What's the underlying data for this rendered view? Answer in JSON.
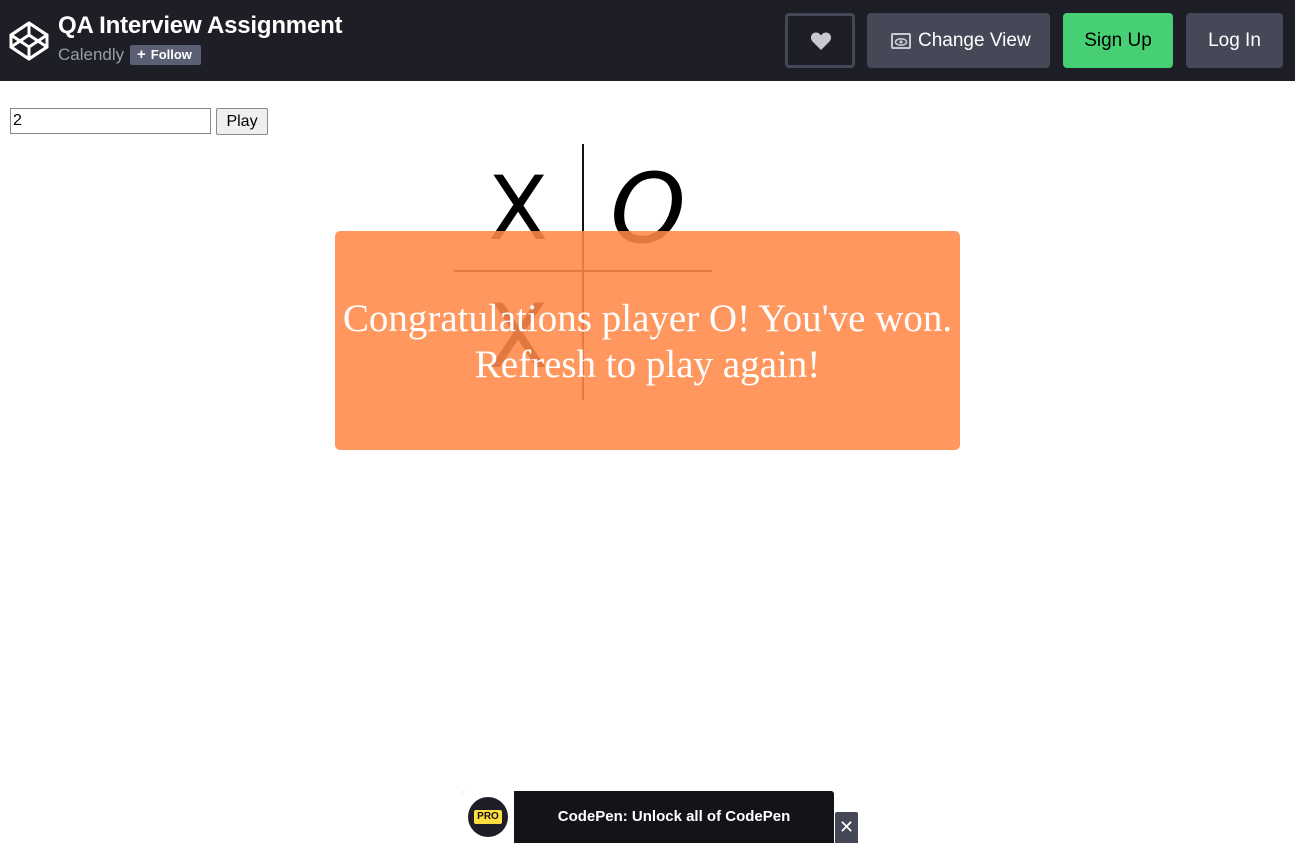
{
  "header": {
    "title": "QA Interview Assignment",
    "owner": "Calendly",
    "follow_plus": "+",
    "follow_label": "Follow",
    "heart_icon": "heart-icon",
    "change_view_label": "Change View",
    "change_view_icon": "eye-icon",
    "sign_up_label": "Sign Up",
    "log_in_label": "Log In",
    "logo_icon": "codepen-logo-icon"
  },
  "game": {
    "size_input_value": "2",
    "play_label": "Play",
    "cells": [
      "X",
      "O",
      "X",
      ""
    ],
    "win_message_line1": "Congratulations player O! You've won.",
    "win_message_line2": "Refresh to play again!"
  },
  "promo": {
    "badge": "PRO",
    "text": "CodePen: Unlock all of CodePen",
    "close_label": "✕"
  },
  "colors": {
    "header_bg": "#1e1f26",
    "button_gray": "#444857",
    "sign_up_green": "#47cf73",
    "modal_orange": "#ff8948",
    "pro_yellow": "#ffdd40"
  }
}
